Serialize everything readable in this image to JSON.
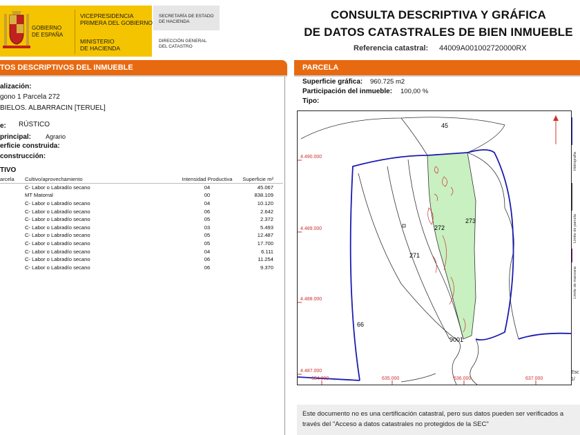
{
  "header": {
    "gov_line1": "GOBIERNO",
    "gov_line2": "DE ESPAÑA",
    "vp_line1": "VICEPRESIDENCIA",
    "vp_line2": "PRIMERA DEL GOBIERNO",
    "min_line1": "MINISTERIO",
    "min_line2": "DE HACIENDA",
    "sec_line1": "SECRETARÍA DE ESTADO",
    "sec_line2": "DE HACIENDA",
    "dg_line1": "DIRECCIÓN GENERAL",
    "dg_line2": "DEL CATASTRO",
    "title_line1": "CONSULTA DESCRIPTIVA Y GRÁFICA",
    "title_line2": "DE DATOS CATASTRALES DE BIEN INMUEBLE",
    "ref_label": "Referencia catastral:",
    "ref_value": "44009A001002720000RX",
    "brand_color": "#f5c400",
    "accent_color": "#e86a10"
  },
  "left": {
    "bar_title": "TOS DESCRIPTIVOS DEL INMUEBLE",
    "loc_label": "alización:",
    "loc_line1": "gono 1 Parcela 272",
    "loc_line2": "BIELOS. ALBARRACIN [TERUEL]",
    "class_label": "e:",
    "class_value": "RÚSTICO",
    "use_label": "principal:",
    "use_value": "Agrario",
    "built_label": "erficie construida:",
    "year_label": "construcción:",
    "cult_title": "TIVO",
    "columns": [
      "arcela",
      "Cultivo/aprovechamiento",
      "Intensidad Productiva",
      "Superficie m²"
    ],
    "rows": [
      {
        "crop": "C- Labor o Labradío secano",
        "intensity": "04",
        "area": "45.067"
      },
      {
        "crop": "MT Matorral",
        "intensity": "00",
        "area": "838.109"
      },
      {
        "crop": "C- Labor o Labradío secano",
        "intensity": "04",
        "area": "10.120"
      },
      {
        "crop": "C- Labor o Labradío secano",
        "intensity": "06",
        "area": "2.642"
      },
      {
        "crop": "C- Labor o Labradío secano",
        "intensity": "05",
        "area": "2.372"
      },
      {
        "crop": "C- Labor o Labradío secano",
        "intensity": "03",
        "area": "5.493"
      },
      {
        "crop": "C- Labor o Labradío secano",
        "intensity": "05",
        "area": "12.487"
      },
      {
        "crop": "C- Labor o Labradío secano",
        "intensity": "05",
        "area": "17.700"
      },
      {
        "crop": "C- Labor o Labradío secano",
        "intensity": "04",
        "area": "6.111"
      },
      {
        "crop": "C- Labor o Labradío secano",
        "intensity": "06",
        "area": "11.254"
      },
      {
        "crop": "C- Labor o Labradío secano",
        "intensity": "06",
        "area": "9.370"
      }
    ]
  },
  "right": {
    "bar_title": "PARCELA",
    "surface_label": "Superficie gráfica:",
    "surface_value": "960.725 m2",
    "share_label": "Participación del inmueble:",
    "share_value": "100,00 %",
    "type_label": "Tipo:",
    "map": {
      "parcel_labels": [
        "45",
        "272",
        "273",
        "271",
        "66",
        "9001"
      ],
      "y_ticks": [
        "4.490.000",
        "4.489.000",
        "4.488.000",
        "4.487.000"
      ],
      "x_ticks": [
        "634.000",
        "635.000",
        "636.000",
        "637.000"
      ],
      "legend": [
        "Hidrografía",
        "Límite de parcela",
        "Límite de manzana"
      ],
      "scale_label": "Esc",
      "scale_value": "1/",
      "parcel_fill": "#c8f0c0",
      "boundary_color": "#1a1ab0"
    },
    "note": "Este documento no es una certificación catastral, pero sus datos pueden ser verificados a través del \"Acceso a datos catastrales no protegidos de la SEC\""
  }
}
